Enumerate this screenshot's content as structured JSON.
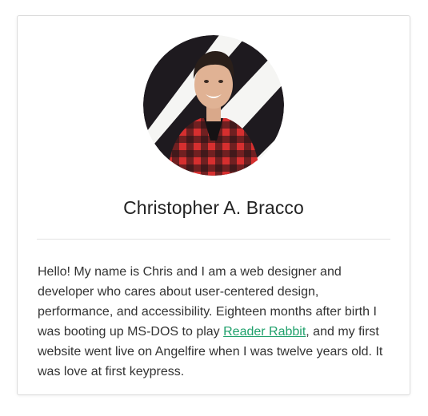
{
  "profile": {
    "name": "Christopher A. Bracco",
    "avatar_alt": "Christopher A. Bracco",
    "bio": {
      "before_link": "Hello! My name is Chris and I am a web designer and developer who cares about user-centered design, performance, and accessibility. Eighteen months after birth I was booting up MS-DOS to play ",
      "link_text": "Reader Rabbit",
      "after_link": ", and my first website went live on Angelfire when I was twelve years old. It was love at first keypress."
    }
  },
  "colors": {
    "link": "#1fa06b",
    "shirt_red": "#d62f2f",
    "stripe_dark": "#1e1a1f"
  }
}
